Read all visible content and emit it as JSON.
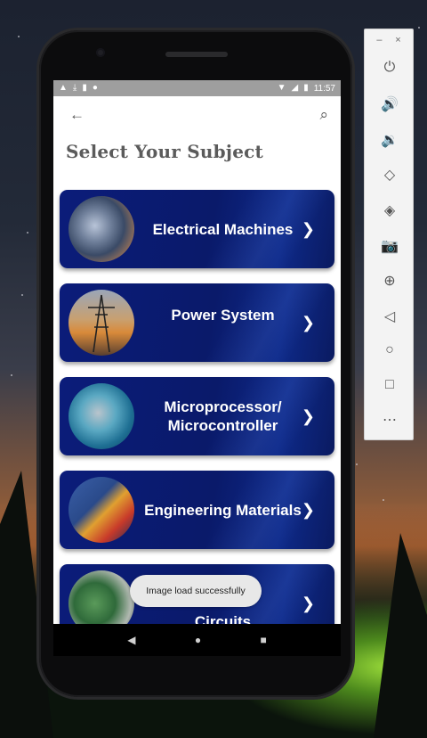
{
  "status_bar": {
    "left_icons": [
      "warning-icon",
      "download-icon",
      "sd-card-icon",
      "circle-icon"
    ],
    "right_icons": [
      "wifi-icon",
      "signal-icon",
      "battery-icon"
    ],
    "time": "11:57"
  },
  "app_bar": {
    "back_icon": "←",
    "search_icon": "⌕"
  },
  "page": {
    "title": "Select Your Subject"
  },
  "subjects": [
    {
      "label": "Electrical Machines",
      "thumb": "machines-image"
    },
    {
      "label": "Power System",
      "thumb": "power-tower-image"
    },
    {
      "label": "Microprocessor/ Microcontroller",
      "thumb": "circuit-board-image"
    },
    {
      "label": "Engineering Materials",
      "thumb": "materials-image"
    },
    {
      "label": "Circuits",
      "thumb": "pcb-image"
    }
  ],
  "toast": {
    "text": "Image load successfully"
  },
  "nav": {
    "back": "◀",
    "home": "●",
    "recents": "■"
  },
  "emulator_toolbar": {
    "minimize": "–",
    "close": "×",
    "buttons": [
      "power-icon",
      "volume-up-icon",
      "volume-down-icon",
      "rotate-left-icon",
      "rotate-right-icon",
      "camera-icon",
      "zoom-icon",
      "back-icon",
      "home-icon",
      "overview-icon",
      "more-icon"
    ]
  },
  "colors": {
    "card_bg": "#0b1c7a",
    "title": "#5b5b5b",
    "status_bar": "#9e9e9e"
  }
}
